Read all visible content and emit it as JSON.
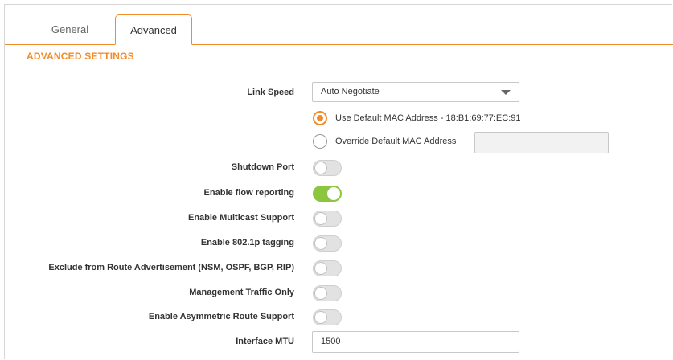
{
  "tabs": [
    {
      "label": "General",
      "active": false
    },
    {
      "label": "Advanced",
      "active": true
    }
  ],
  "section_title": "ADVANCED SETTINGS",
  "link_speed": {
    "label": "Link Speed",
    "value": "Auto Negotiate"
  },
  "mac": {
    "default_label": "Use Default MAC Address - 18:B1:69:77:EC:91",
    "default_selected": true,
    "override_label": "Override Default MAC Address",
    "override_value": ""
  },
  "toggles": [
    {
      "label": "Shutdown Port",
      "on": false
    },
    {
      "label": "Enable flow reporting",
      "on": true
    },
    {
      "label": "Enable Multicast Support",
      "on": false
    },
    {
      "label": "Enable 802.1p tagging",
      "on": false
    },
    {
      "label": "Exclude from Route Advertisement (NSM, OSPF, BGP, RIP)",
      "on": false
    },
    {
      "label": "Management Traffic Only",
      "on": false
    },
    {
      "label": "Enable Asymmetric Route Support",
      "on": false
    }
  ],
  "mtu": {
    "label": "Interface MTU",
    "value": "1500"
  },
  "colors": {
    "accent": "#f28c28",
    "toggle_on": "#8cc63f"
  }
}
